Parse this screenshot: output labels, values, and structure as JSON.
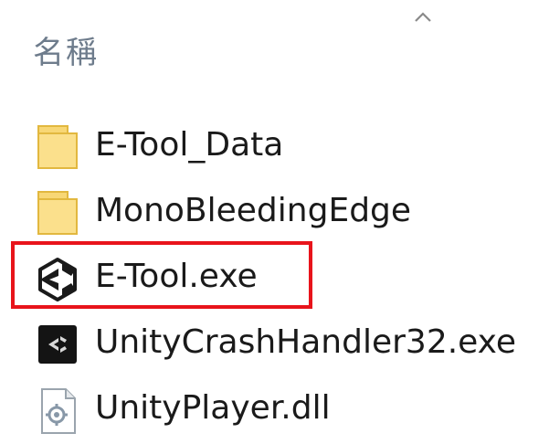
{
  "column_header": {
    "label": "名稱",
    "sort_icon": "chevron-up-icon"
  },
  "files": [
    {
      "name": "E-Tool_Data",
      "icon": "folder-icon",
      "type": "folder"
    },
    {
      "name": "MonoBleedingEdge",
      "icon": "folder-icon",
      "type": "folder"
    },
    {
      "name": "E-Tool.exe",
      "icon": "unity-logo-icon",
      "type": "exe"
    },
    {
      "name": "UnityCrashHandler32.exe",
      "icon": "unity-crash-handler-icon",
      "type": "exe"
    },
    {
      "name": "UnityPlayer.dll",
      "icon": "dll-file-icon",
      "type": "dll"
    }
  ],
  "annotation": {
    "highlight_color": "#e8141b"
  },
  "colors": {
    "folder_fill": "#f8d775",
    "folder_edge": "#e2b83f",
    "header_text": "#6e7c8c"
  }
}
